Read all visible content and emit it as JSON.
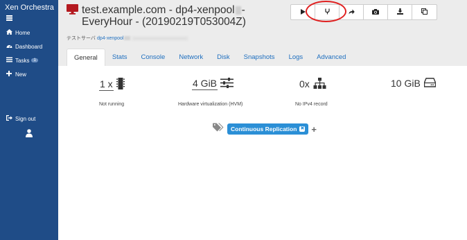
{
  "sidebar": {
    "brand": "Xen Orchestra",
    "items": [
      {
        "label": "Home"
      },
      {
        "label": "Dashboard"
      },
      {
        "label": "Tasks",
        "badge": "1"
      },
      {
        "label": "New"
      }
    ],
    "signout": "Sign out"
  },
  "header": {
    "title_part1": "test.example.com - dp4-xenpool",
    "title_part2": "-",
    "title_line2": "EveryHour - (20190219T053004Z)",
    "host_prefix": "テストサーバ",
    "host_link": "dp4-xenpool"
  },
  "toolbar": {
    "buttons": [
      "start",
      "clone",
      "migrate",
      "snapshot",
      "export",
      "copy"
    ]
  },
  "tabs": [
    "General",
    "Stats",
    "Console",
    "Network",
    "Disk",
    "Snapshots",
    "Logs",
    "Advanced"
  ],
  "active_tab": "General",
  "stats": {
    "cpu": {
      "value": "1 x",
      "caption": "Not running"
    },
    "memory": {
      "value": "4 GiB",
      "caption": "Hardware virtualization (HVM)"
    },
    "network": {
      "value": "0x",
      "caption": "No IPv4 record"
    },
    "disk": {
      "value": "10 GiB"
    }
  },
  "tags": {
    "items": [
      "Continuous Replication"
    ]
  },
  "colors": {
    "sidebar_bg": "#1f4c87",
    "accent": "#2b8fd6",
    "header_bg": "#ececec",
    "vm_icon": "#b4191f",
    "highlight": "#e02020"
  }
}
